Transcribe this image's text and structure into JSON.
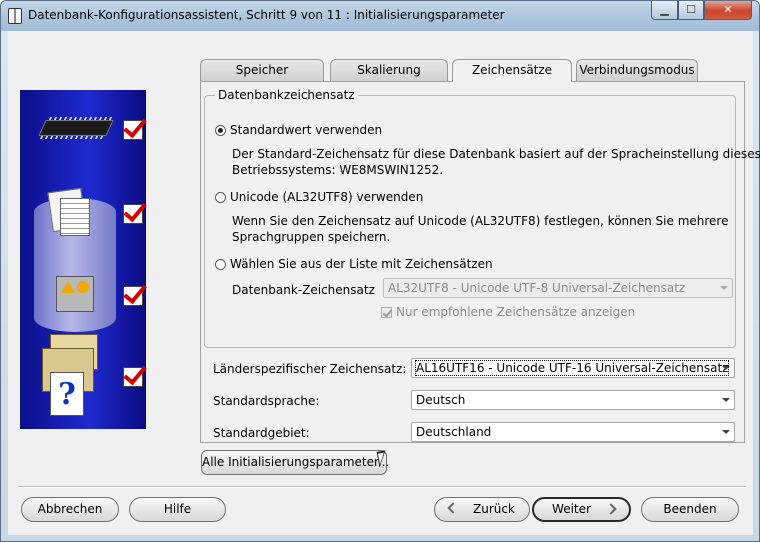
{
  "window": {
    "title": "Datenbank-Konfigurationsassistent, Schritt 9 von 11 : Initialisierungsparameter",
    "minimize_glyph": "▁",
    "maximize_glyph": "☐",
    "close_glyph": "✕"
  },
  "tabs": [
    {
      "label": "Speicher",
      "active": false
    },
    {
      "label": "Skalierung",
      "active": false
    },
    {
      "label": "Zeichensätze",
      "active": true
    },
    {
      "label": "Verbindungsmodus",
      "active": false
    }
  ],
  "charset_group": {
    "legend": "Datenbankzeichensatz",
    "option_default": {
      "label": "Standardwert verwenden",
      "selected": true,
      "desc_line1": "Der Standard-Zeichensatz für diese Datenbank basiert auf der Spracheinstellung dieses",
      "desc_line2": "Betriebssystems: WE8MSWIN1252."
    },
    "option_unicode": {
      "label": "Unicode (AL32UTF8) verwenden",
      "selected": false,
      "desc_line1": "Wenn Sie den Zeichensatz auf Unicode (AL32UTF8) festlegen, können Sie mehrere",
      "desc_line2": "Sprachgruppen speichern."
    },
    "option_list": {
      "label": "Wählen Sie aus der Liste mit Zeichensätzen",
      "selected": false
    },
    "db_charset_label": "Datenbank-Zeichensatz",
    "db_charset_value": "AL32UTF8 - Unicode UTF-8 Universal-Zeichensatz",
    "recommended_only_label": "Nur empfohlene Zeichensätze anzeigen",
    "recommended_only_checked": true
  },
  "national_charset": {
    "label": "Länderspezifischer Zeichensatz:",
    "value": "AL16UTF16 - Unicode UTF-16 Universal-Zeichensatz"
  },
  "default_language": {
    "label": "Standardsprache:",
    "value": "Deutsch"
  },
  "default_territory": {
    "label": "Standardgebiet:",
    "value": "Deutschland"
  },
  "all_params_button": "Alle Initialisierungsparameter...",
  "buttons": {
    "cancel": "Abbrechen",
    "help": "Hilfe",
    "back": "Zurück",
    "next": "Weiter",
    "finish": "Beenden"
  },
  "icons": {
    "app": "database-icon",
    "step_graphic": [
      "chip-icon",
      "document-icon",
      "database-cylinder-icon",
      "shapes-icon",
      "folder-icon",
      "help-document-icon"
    ],
    "check_color": "#d40000"
  },
  "colors": {
    "graphic_blue": "#1f2ad0",
    "panel_bg": "#f0f0f0"
  }
}
